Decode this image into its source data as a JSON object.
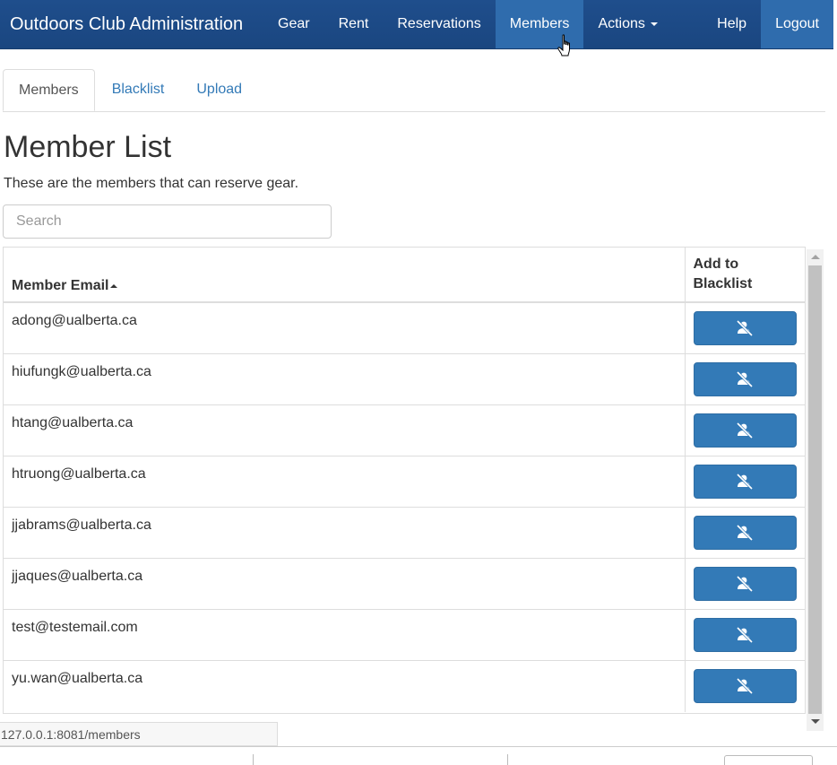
{
  "navbar": {
    "brand": "Outdoors Club Administration",
    "items": [
      {
        "label": "Gear"
      },
      {
        "label": "Rent"
      },
      {
        "label": "Reservations"
      },
      {
        "label": "Members"
      },
      {
        "label": "Actions"
      }
    ],
    "help": "Help",
    "logout": "Logout",
    "active": "Members"
  },
  "tabs": [
    {
      "label": "Members",
      "active": true
    },
    {
      "label": "Blacklist",
      "active": false
    },
    {
      "label": "Upload",
      "active": false
    }
  ],
  "page": {
    "title": "Member List",
    "description": "These are the members that can reserve gear."
  },
  "search": {
    "placeholder": "Search",
    "value": ""
  },
  "table": {
    "columns": [
      "Member Email",
      "Add to Blacklist"
    ],
    "sort": "ascending",
    "rows": [
      {
        "email": "adong@ualberta.ca",
        "action_icon": "user-slash-icon"
      },
      {
        "email": "hiufungk@ualberta.ca",
        "action_icon": "user-slash-icon"
      },
      {
        "email": "htang@ualberta.ca",
        "action_icon": "user-slash-icon"
      },
      {
        "email": "htruong@ualberta.ca",
        "action_icon": "user-slash-icon"
      },
      {
        "email": "jjabrams@ualberta.ca",
        "action_icon": "user-slash-icon"
      },
      {
        "email": "jjaques@ualberta.ca",
        "action_icon": "user-slash-icon"
      },
      {
        "email": "test@testemail.com",
        "action_icon": "user-slash-icon"
      },
      {
        "email": "yu.wan@ualberta.ca",
        "action_icon": "user-slash-icon"
      }
    ]
  },
  "status_bar": {
    "url": "127.0.0.1:8081/members"
  },
  "colors": {
    "navbar": "#1f4e8c",
    "nav_active": "#2f6cad",
    "link": "#337ab7",
    "button": "#337ab7"
  }
}
